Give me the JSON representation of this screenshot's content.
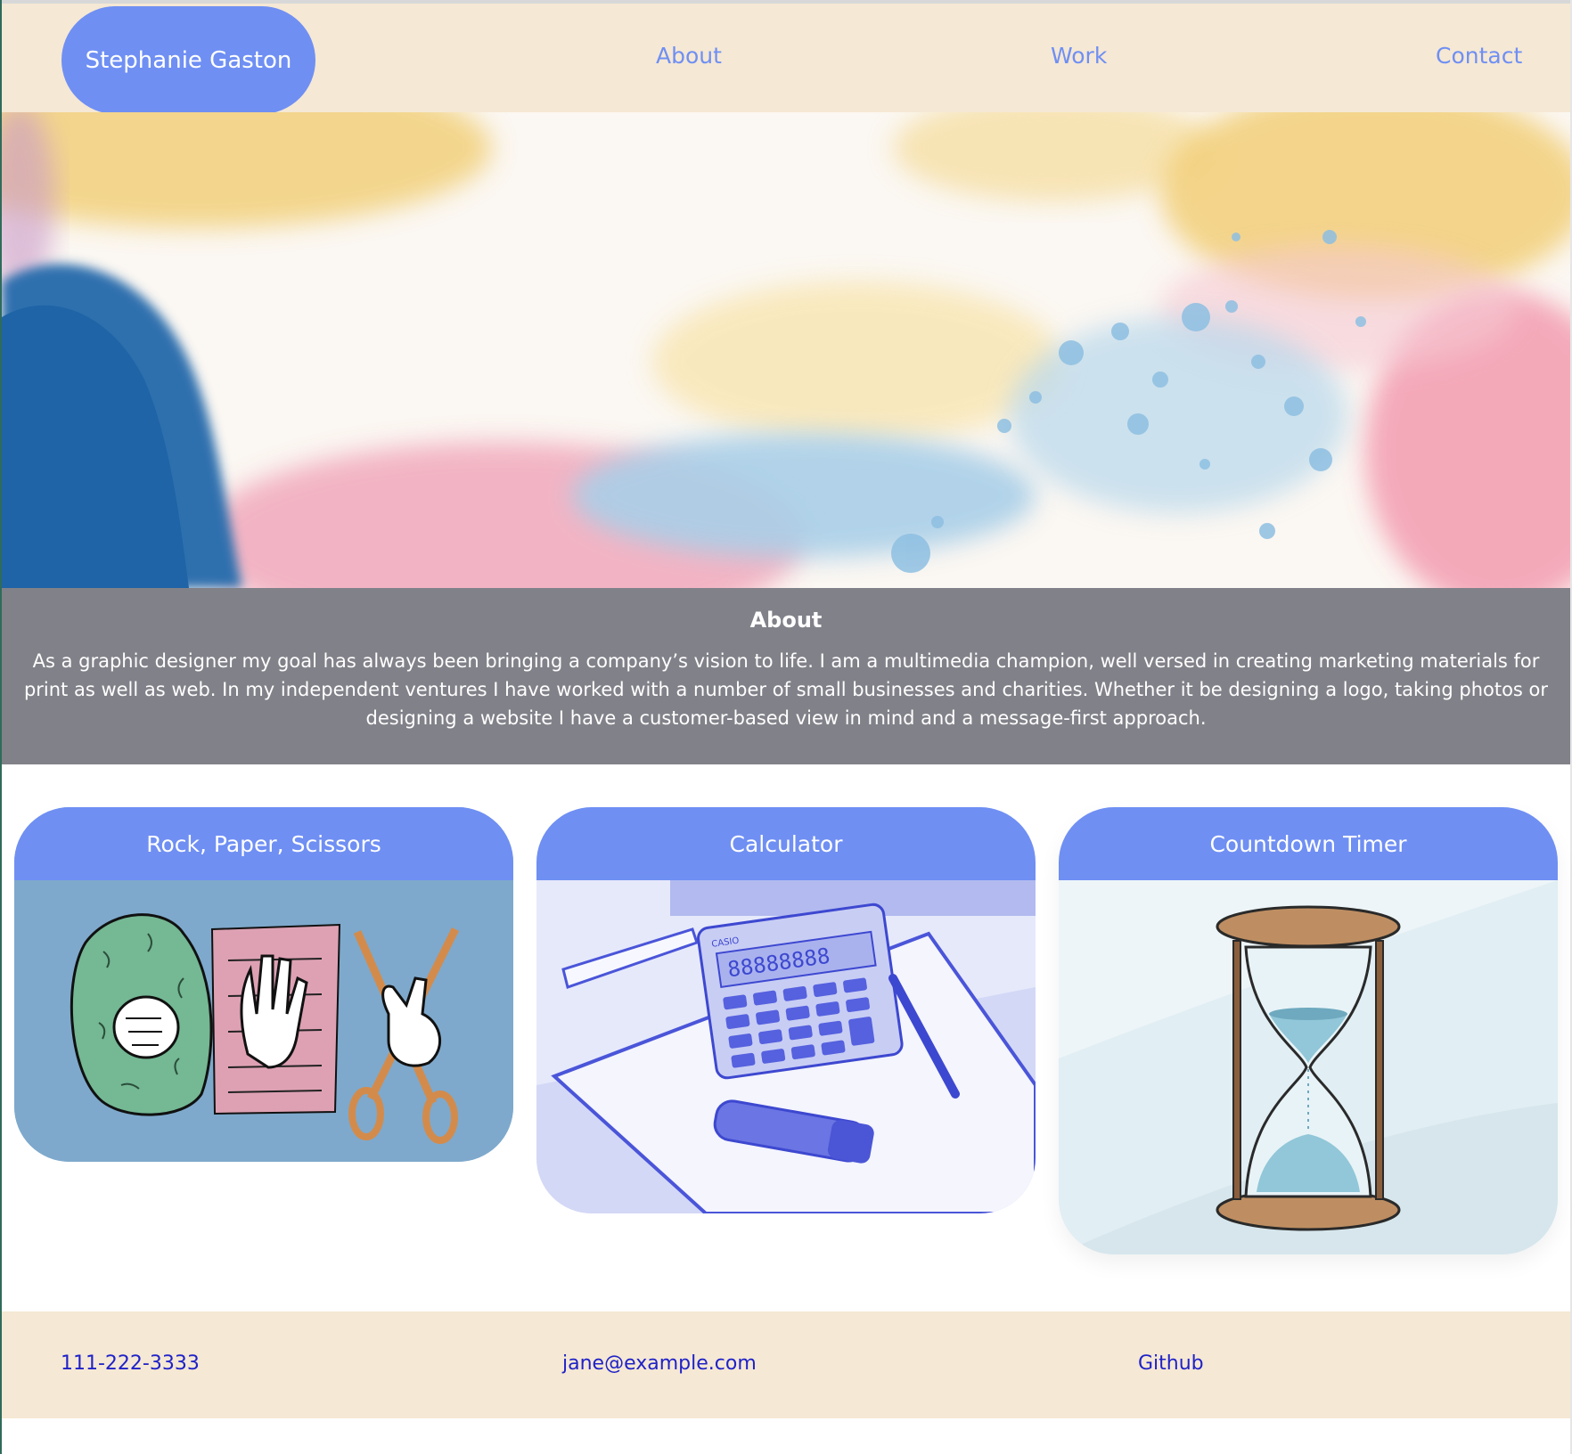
{
  "header": {
    "brand": "Stephanie Gaston",
    "nav": {
      "about": "About",
      "work": "Work",
      "contact": "Contact"
    }
  },
  "about": {
    "heading": "About",
    "text": "As a graphic designer my goal has always been bringing a company’s vision to life. I am a multimedia champion, well versed in creating marketing materials for print as well as web. In my independent ventures I have worked with a number of small businesses and charities. Whether it be designing a logo, taking photos or designing a website I have a customer-based view in mind and a message-first approach."
  },
  "projects": [
    {
      "title": "Rock, Paper, Scissors",
      "image_icon": "rock-paper-scissors-hands-icon"
    },
    {
      "title": "Calculator",
      "image_icon": "calculator-icon",
      "calculator_brand": "CASIO",
      "calculator_display": "88888888"
    },
    {
      "title": "Countdown Timer",
      "image_icon": "hourglass-icon"
    }
  ],
  "footer": {
    "phone": "111-222-3333",
    "email": "jane@example.com",
    "github": "Github"
  },
  "colors": {
    "accent": "#6f8ff3",
    "cream": "#f5e8d4",
    "about_bg": "#818189",
    "footer_link": "#1f22c8"
  }
}
